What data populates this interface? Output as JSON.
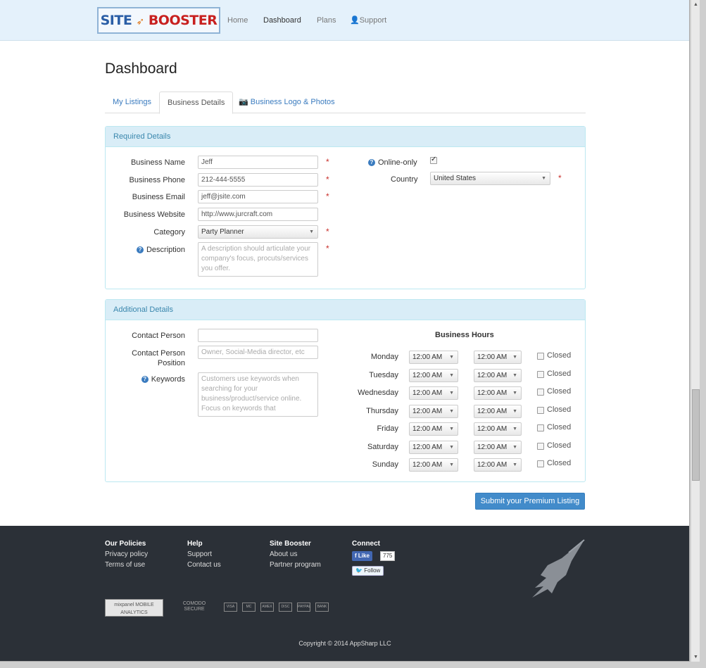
{
  "header": {
    "logo": {
      "part1": "SITE",
      "part2": "BOOSTER"
    },
    "nav": [
      {
        "label": "Home"
      },
      {
        "label": "Dashboard"
      },
      {
        "label": "Plans"
      },
      {
        "label": "Support"
      }
    ]
  },
  "page_title": "Dashboard",
  "tabs": [
    {
      "label": "My Listings"
    },
    {
      "label": "Business Details"
    },
    {
      "label": "Business Logo & Photos"
    }
  ],
  "required": {
    "heading": "Required Details",
    "business_name": {
      "label": "Business Name",
      "value": "Jeff"
    },
    "business_phone": {
      "label": "Business Phone",
      "value": "212-444-5555"
    },
    "business_email": {
      "label": "Business Email",
      "value": "jeff@jsite.com"
    },
    "business_website": {
      "label": "Business Website",
      "value": "http://www.jurcraft.com"
    },
    "category": {
      "label": "Category",
      "value": "Party Planner"
    },
    "description": {
      "label": "Description",
      "placeholder": "A description should articulate your company's focus, procuts/services you offer."
    },
    "online_only": {
      "label": "Online-only",
      "checked": true
    },
    "country": {
      "label": "Country",
      "value": "United States"
    }
  },
  "additional": {
    "heading": "Additional Details",
    "contact_person": {
      "label": "Contact Person",
      "value": ""
    },
    "contact_position": {
      "label_line1": "Contact Person",
      "label_line2": "Position",
      "placeholder": "Owner, Social-Media director, etc"
    },
    "keywords": {
      "label": "Keywords",
      "placeholder": "Customers use keywords when searching for your business/product/service online. Focus on keywords that"
    },
    "hours_title": "Business Hours",
    "closed_label": "Closed",
    "days": [
      {
        "day": "Monday",
        "open": "12:00 AM",
        "close": "12:00 AM"
      },
      {
        "day": "Tuesday",
        "open": "12:00 AM",
        "close": "12:00 AM"
      },
      {
        "day": "Wednesday",
        "open": "12:00 AM",
        "close": "12:00 AM"
      },
      {
        "day": "Thursday",
        "open": "12:00 AM",
        "close": "12:00 AM"
      },
      {
        "day": "Friday",
        "open": "12:00 AM",
        "close": "12:00 AM"
      },
      {
        "day": "Saturday",
        "open": "12:00 AM",
        "close": "12:00 AM"
      },
      {
        "day": "Sunday",
        "open": "12:00 AM",
        "close": "12:00 AM"
      }
    ]
  },
  "submit_label": "Submit your Premium Listing",
  "footer": {
    "policies": {
      "title": "Our Policies",
      "links": [
        "Privacy policy",
        "Terms of use"
      ]
    },
    "help": {
      "title": "Help",
      "links": [
        "Support",
        "Contact us"
      ]
    },
    "site": {
      "title": "Site Booster",
      "links": [
        "About us",
        "Partner program"
      ]
    },
    "connect": {
      "title": "Connect",
      "like": "Like",
      "like_count": "775",
      "follow": "Follow"
    },
    "mixpanel": "mixpanel MOBILE ANALYTICS",
    "comodo": "COMODO SECURE",
    "payments": [
      "VISA",
      "MC",
      "AMEX",
      "DISC",
      "PAYPAL",
      "BANK"
    ],
    "copyright": "Copyright © 2014 AppSharp LLC"
  }
}
